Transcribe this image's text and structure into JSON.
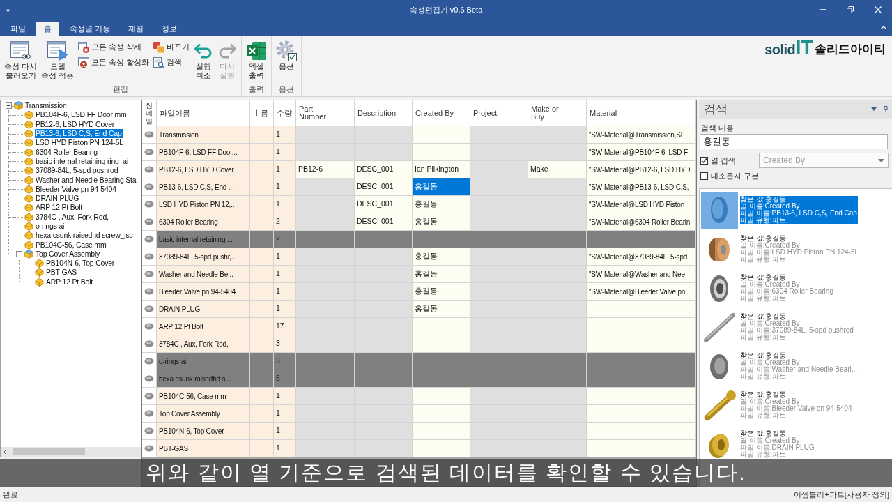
{
  "window": {
    "title": "속성편집기 v0.6 Beta"
  },
  "ribbon_tabs": [
    {
      "label": "파일",
      "selected": false
    },
    {
      "label": "홈",
      "selected": true
    },
    {
      "label": "속성열 기능",
      "selected": false
    },
    {
      "label": "재질",
      "selected": false
    },
    {
      "label": "정보",
      "selected": false
    }
  ],
  "logo": {
    "wordmark": "solid",
    "mark": "IT",
    "text": "솔리드아이티"
  },
  "ribbon": {
    "groups": [
      {
        "label": "편집",
        "items": [
          {
            "kind": "large",
            "lines": [
              "속성 다시",
              "불러오기"
            ],
            "disabled": false
          },
          {
            "kind": "large",
            "lines": [
              "모델",
              "속성 적용"
            ],
            "disabled": false
          },
          {
            "kind": "stack",
            "buttons": [
              {
                "label": "모든 속성 삭제",
                "disabled": false
              },
              {
                "label": "모든 속성 활성화",
                "disabled": false
              }
            ]
          },
          {
            "kind": "stack",
            "buttons": [
              {
                "label": "바꾸기",
                "disabled": false
              },
              {
                "label": "검색",
                "disabled": false
              }
            ]
          },
          {
            "kind": "large",
            "lines": [
              "실행",
              "취소"
            ],
            "disabled": false
          },
          {
            "kind": "large",
            "lines": [
              "다시",
              "실행"
            ],
            "disabled": true
          }
        ]
      },
      {
        "label": "출력",
        "items": [
          {
            "kind": "large",
            "lines": [
              "엑셀",
              "출력"
            ],
            "disabled": false
          }
        ]
      },
      {
        "label": "옵션",
        "items": [
          {
            "kind": "large",
            "lines": [
              "옵션"
            ],
            "disabled": false
          }
        ]
      }
    ]
  },
  "tree": {
    "items": [
      {
        "label": "Transmission",
        "kind": "assembly",
        "expanded": true,
        "selected": false,
        "children": [
          {
            "label": "PB104F-6, LSD FF Door mm",
            "kind": "part",
            "selected": false
          },
          {
            "label": "PB12-6, LSD HYD Cover",
            "kind": "part",
            "selected": false
          },
          {
            "label": "PB13-6, LSD C,S, End Cap",
            "kind": "part",
            "selected": true
          },
          {
            "label": "LSD HYD Piston PN 124-5L",
            "kind": "part",
            "selected": false
          },
          {
            "label": "6304 Roller Bearing",
            "kind": "part",
            "selected": false
          },
          {
            "label": "basic internal retaining ring_ai",
            "kind": "part",
            "selected": false
          },
          {
            "label": "37089-84L, 5-spd pushrod",
            "kind": "part",
            "selected": false
          },
          {
            "label": "Washer and Needle Bearing Sta",
            "kind": "part",
            "selected": false
          },
          {
            "label": "Bleeder Valve pn 94-5404",
            "kind": "part",
            "selected": false
          },
          {
            "label": "DRAIN PLUG",
            "kind": "part",
            "selected": false
          },
          {
            "label": "ARP 12 Pt Bolt",
            "kind": "part",
            "selected": false
          },
          {
            "label": "3784C , Aux, Fork Rod,",
            "kind": "part",
            "selected": false
          },
          {
            "label": "o-rings ai",
            "kind": "part",
            "selected": false
          },
          {
            "label": "hexa csunk raisedhd screw_isc",
            "kind": "part",
            "selected": false
          },
          {
            "label": "PB104C-56, Case mm",
            "kind": "part",
            "selected": false
          },
          {
            "label": "Top Cover Assembly",
            "kind": "assembly",
            "expanded": true,
            "selected": false,
            "children": [
              {
                "label": "PB104N-6, Top Cover",
                "kind": "part",
                "selected": false
              },
              {
                "label": "PBT-GAS",
                "kind": "part",
                "selected": false
              },
              {
                "label": "ARP 12 Pt Bolt",
                "kind": "part",
                "selected": false
              }
            ]
          }
        ]
      }
    ]
  },
  "table": {
    "thumbnail_header": "썸네일",
    "columns": [
      {
        "label": "파일이름",
        "kind": "key"
      },
      {
        "label": "ㅣ름",
        "kind": "key"
      },
      {
        "label": "수량",
        "kind": "key"
      },
      {
        "label": "Part Number",
        "kind": "property",
        "blank_shaded": true
      },
      {
        "label": "Description",
        "kind": "property",
        "blank_shaded": true
      },
      {
        "label": "Created By",
        "kind": "property",
        "blank_shaded": false
      },
      {
        "label": "Project",
        "kind": "property",
        "blank_shaded": true
      },
      {
        "label": "Make or Buy",
        "kind": "property",
        "blank_shaded": true
      },
      {
        "label": "Material",
        "kind": "property",
        "blank_shaded": false
      }
    ],
    "rows": [
      {
        "disabled": false,
        "cells": [
          {
            "text": "Transmission",
            "selected": false
          },
          {
            "selected": false
          },
          {
            "text": "1",
            "selected": false
          },
          {
            "selected": false
          },
          {
            "selected": false
          },
          {
            "selected": false
          },
          {
            "selected": false
          },
          {
            "selected": false
          },
          {
            "text": "\"SW-Material@Transmission,SL",
            "selected": false
          }
        ]
      },
      {
        "disabled": false,
        "cells": [
          {
            "text": "PB104F-6, LSD FF Door,..",
            "selected": false
          },
          {
            "selected": false
          },
          {
            "text": "1",
            "selected": false
          },
          {
            "selected": false
          },
          {
            "selected": false
          },
          {
            "selected": false
          },
          {
            "selected": false
          },
          {
            "selected": false
          },
          {
            "text": "\"SW-Material@PB104F-6, LSD F",
            "selected": false
          }
        ]
      },
      {
        "disabled": false,
        "cells": [
          {
            "text": "PB12-6, LSD HYD Cover",
            "selected": false
          },
          {
            "selected": false
          },
          {
            "text": "1",
            "selected": false
          },
          {
            "text": "PB12-6",
            "selected": false
          },
          {
            "text": "DESC_001",
            "selected": false
          },
          {
            "text": "Ian Pilkington",
            "selected": false
          },
          {
            "selected": false
          },
          {
            "text": "Make",
            "selected": false
          },
          {
            "text": "\"SW-Material@PB12-6, LSD HYD",
            "selected": false
          }
        ]
      },
      {
        "disabled": false,
        "cells": [
          {
            "text": "PB13-6, LSD C,S, End ...",
            "selected": false
          },
          {
            "selected": false
          },
          {
            "text": "1",
            "selected": false
          },
          {
            "selected": false
          },
          {
            "text": "DESC_001",
            "selected": false
          },
          {
            "text": "홍길동",
            "selected": true
          },
          {
            "selected": false
          },
          {
            "selected": false
          },
          {
            "text": "\"SW-Material@PB13-6, LSD C,S,",
            "selected": false
          }
        ]
      },
      {
        "disabled": false,
        "cells": [
          {
            "text": "LSD HYD Piston PN 12,..",
            "selected": false
          },
          {
            "selected": false
          },
          {
            "text": "1",
            "selected": false
          },
          {
            "selected": false
          },
          {
            "text": "DESC_001",
            "selected": false
          },
          {
            "text": "홍길동",
            "selected": false
          },
          {
            "selected": false
          },
          {
            "selected": false
          },
          {
            "text": "\"SW-Material@LSD HYD Piston",
            "selected": false
          }
        ]
      },
      {
        "disabled": false,
        "cells": [
          {
            "text": "6304 Roller Bearing",
            "selected": false
          },
          {
            "selected": false
          },
          {
            "text": "2",
            "selected": false
          },
          {
            "selected": false
          },
          {
            "text": "DESC_001",
            "selected": false
          },
          {
            "text": "홍길동",
            "selected": false
          },
          {
            "selected": false
          },
          {
            "selected": false
          },
          {
            "text": "\"SW-Material@6304 Roller Bearin",
            "selected": false
          }
        ]
      },
      {
        "disabled": true,
        "cells": [
          {
            "text": "basic internal retaining ...",
            "selected": false
          },
          {
            "selected": false
          },
          {
            "text": "2",
            "selected": false
          },
          {
            "selected": false
          },
          {
            "selected": false
          },
          {
            "selected": false
          },
          {
            "selected": false
          },
          {
            "selected": false
          },
          {
            "selected": false
          }
        ]
      },
      {
        "disabled": false,
        "cells": [
          {
            "text": "37089-84L, 5-spd pushr,..",
            "selected": false
          },
          {
            "selected": false
          },
          {
            "text": "1",
            "selected": false
          },
          {
            "selected": false
          },
          {
            "selected": false
          },
          {
            "text": "홍길동",
            "selected": false
          },
          {
            "selected": false
          },
          {
            "selected": false
          },
          {
            "text": "\"SW-Material@37089-84L, 5-spd",
            "selected": false
          }
        ]
      },
      {
        "disabled": false,
        "cells": [
          {
            "text": "Washer and Needle Be,..",
            "selected": false
          },
          {
            "selected": false
          },
          {
            "text": "1",
            "selected": false
          },
          {
            "selected": false
          },
          {
            "selected": false
          },
          {
            "text": "홍길동",
            "selected": false
          },
          {
            "selected": false
          },
          {
            "selected": false
          },
          {
            "text": "\"SW-Material@Washer and Nee",
            "selected": false
          }
        ]
      },
      {
        "disabled": false,
        "cells": [
          {
            "text": "Bleeder Valve pn 94-5404",
            "selected": false
          },
          {
            "selected": false
          },
          {
            "text": "1",
            "selected": false
          },
          {
            "selected": false
          },
          {
            "selected": false
          },
          {
            "text": "홍길동",
            "selected": false
          },
          {
            "selected": false
          },
          {
            "selected": false
          },
          {
            "text": "\"SW-Material@Bleeder Valve pn",
            "selected": false
          }
        ]
      },
      {
        "disabled": false,
        "cells": [
          {
            "text": "DRAIN PLUG",
            "selected": false
          },
          {
            "selected": false
          },
          {
            "text": "1",
            "selected": false
          },
          {
            "selected": false
          },
          {
            "selected": false
          },
          {
            "text": "홍길동",
            "selected": false
          },
          {
            "selected": false
          },
          {
            "selected": false
          },
          {
            "selected": false
          }
        ]
      },
      {
        "disabled": false,
        "cells": [
          {
            "text": "ARP 12 Pt Bolt",
            "selected": false
          },
          {
            "selected": false
          },
          {
            "text": "17",
            "selected": false
          },
          {
            "selected": false
          },
          {
            "selected": false
          },
          {
            "selected": false
          },
          {
            "selected": false
          },
          {
            "selected": false
          },
          {
            "selected": false
          }
        ]
      },
      {
        "disabled": false,
        "cells": [
          {
            "text": "3784C , Aux, Fork Rod,",
            "selected": false
          },
          {
            "selected": false
          },
          {
            "text": "3",
            "selected": false
          },
          {
            "selected": false
          },
          {
            "selected": false
          },
          {
            "selected": false
          },
          {
            "selected": false
          },
          {
            "selected": false
          },
          {
            "selected": false
          }
        ]
      },
      {
        "disabled": true,
        "cells": [
          {
            "text": "o-rings ai",
            "selected": false
          },
          {
            "selected": false
          },
          {
            "text": "3",
            "selected": false
          },
          {
            "selected": false
          },
          {
            "selected": false
          },
          {
            "selected": false
          },
          {
            "selected": false
          },
          {
            "selected": false
          },
          {
            "selected": false
          }
        ]
      },
      {
        "disabled": true,
        "cells": [
          {
            "text": "hexa csunk raisedhd s,..",
            "selected": false
          },
          {
            "selected": false
          },
          {
            "text": "6",
            "selected": false
          },
          {
            "selected": false
          },
          {
            "selected": false
          },
          {
            "selected": false
          },
          {
            "selected": false
          },
          {
            "selected": false
          },
          {
            "selected": false
          }
        ]
      },
      {
        "disabled": false,
        "cells": [
          {
            "text": "PB104C-56, Case mm",
            "selected": false
          },
          {
            "selected": false
          },
          {
            "text": "1",
            "selected": false
          },
          {
            "selected": false
          },
          {
            "selected": false
          },
          {
            "selected": false
          },
          {
            "selected": false
          },
          {
            "selected": false
          },
          {
            "selected": false
          }
        ]
      },
      {
        "disabled": false,
        "cells": [
          {
            "text": "Top Cover Assembly",
            "selected": false
          },
          {
            "selected": false
          },
          {
            "text": "1",
            "selected": false
          },
          {
            "selected": false
          },
          {
            "selected": false
          },
          {
            "selected": false
          },
          {
            "selected": false
          },
          {
            "selected": false
          },
          {
            "selected": false
          }
        ]
      },
      {
        "disabled": false,
        "cells": [
          {
            "text": "PB104N-6, Top Cover",
            "selected": false
          },
          {
            "selected": false
          },
          {
            "text": "1",
            "selected": false
          },
          {
            "selected": false
          },
          {
            "selected": false
          },
          {
            "selected": false
          },
          {
            "selected": false
          },
          {
            "selected": false
          },
          {
            "selected": false
          }
        ]
      },
      {
        "disabled": false,
        "cells": [
          {
            "text": "PBT-GAS",
            "selected": false
          },
          {
            "selected": false
          },
          {
            "text": "1",
            "selected": false
          },
          {
            "selected": false
          },
          {
            "selected": false
          },
          {
            "selected": false
          },
          {
            "selected": false
          },
          {
            "selected": false
          },
          {
            "selected": false
          }
        ]
      }
    ]
  },
  "search_panel": {
    "title": "검색",
    "query_label": "검색 내용",
    "query": "홍길동",
    "options": [
      {
        "label": "열 검색",
        "checked": true
      },
      {
        "label": "대소문자 구분",
        "checked": false
      }
    ],
    "column_select": "Created By",
    "results": [
      {
        "found": "찾은 값:홍길동",
        "column": "열 이름:Created By",
        "file": "파일 이름:PB13-6, LSD C,S, End Cap",
        "type": "파일 유형:파트",
        "selected": true
      },
      {
        "found": "찾은 값:홍길동",
        "column": "열 이름:Created By",
        "file": "파일 이름:LSD HYD Piston PN 124-5L",
        "type": "파일 유형:파트",
        "selected": false
      },
      {
        "found": "찾은 값:홍길동",
        "column": "열 이름:Created By",
        "file": "파일 이름:6304 Roller Bearing",
        "type": "파일 유형:파트",
        "selected": false
      },
      {
        "found": "찾은 값:홍길동",
        "column": "열 이름:Created By",
        "file": "파일 이름:37089-84L, 5-spd pushrod",
        "type": "파일 유형:파트",
        "selected": false
      },
      {
        "found": "찾은 값:홍길동",
        "column": "열 이름:Created By",
        "file": "파일 이름:Washer and Needle Beari,..",
        "type": "파일 유형:파트",
        "selected": false
      },
      {
        "found": "찾은 값:홍길동",
        "column": "열 이름:Created By",
        "file": "파일 이름:Bleeder Valve pn 94-5404",
        "type": "파일 유형:파트",
        "selected": false
      },
      {
        "found": "찾은 값:홍길동",
        "column": "열 이름:Created By",
        "file": "파일 이름:DRAIN PLUG",
        "type": "파일 유형:파트",
        "selected": false
      }
    ]
  },
  "status_bar": {
    "left": "완료",
    "right": "어셈블리+파트[사용자 정의]"
  },
  "caption": "위와 같이 열 기준으로 검색된 데이터를 확인할 수 있습니다."
}
